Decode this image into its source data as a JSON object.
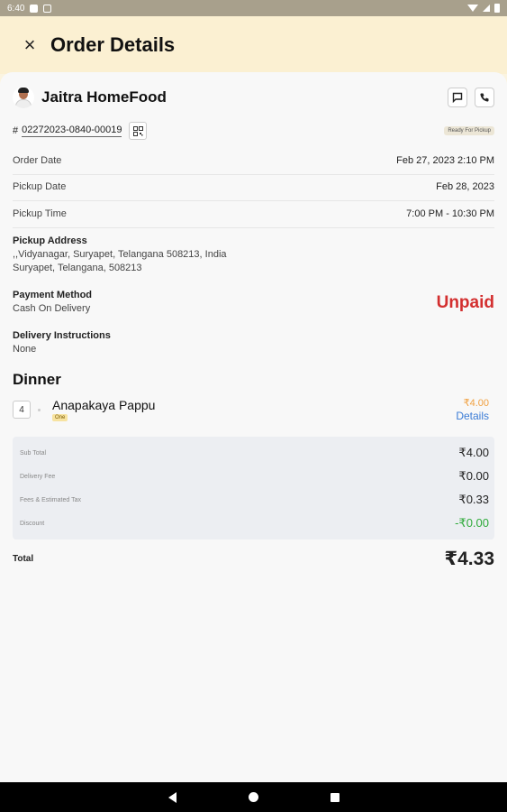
{
  "status_bar": {
    "time": "6:40"
  },
  "header": {
    "title": "Order Details",
    "close_icon": "×"
  },
  "vendor": {
    "name": "Jaitra HomeFood"
  },
  "order": {
    "hash": "#",
    "id": "02272023-0840-00019",
    "status": "Ready For Pickup"
  },
  "details": {
    "order_date_label": "Order Date",
    "order_date_value": "Feb 27, 2023 2:10 PM",
    "pickup_date_label": "Pickup Date",
    "pickup_date_value": "Feb 28, 2023",
    "pickup_time_label": "Pickup Time",
    "pickup_time_value": "7:00 PM - 10:30 PM",
    "pickup_address_label": "Pickup Address",
    "pickup_address_line1": ",,Vidyanagar, Suryapet, Telangana 508213, India",
    "pickup_address_line2": "Suryapet, Telangana, 508213",
    "payment_method_label": "Payment Method",
    "payment_method_value": "Cash On Delivery",
    "payment_status": "Unpaid",
    "delivery_instructions_label": "Delivery Instructions",
    "delivery_instructions_value": "None"
  },
  "section": {
    "title": "Dinner",
    "items": [
      {
        "qty": "4",
        "name": "Anapakaya Pappu",
        "tag": "One",
        "price": "₹4.00",
        "details_label": "Details"
      }
    ]
  },
  "summary": {
    "subtotal_label": "Sub Total",
    "subtotal_value": "₹4.00",
    "delivery_fee_label": "Delivery Fee",
    "delivery_fee_value": "₹0.00",
    "fees_tax_label": "Fees & Estimated Tax",
    "fees_tax_value": "₹0.33",
    "discount_label": "Discount",
    "discount_value": "-₹0.00",
    "total_label": "Total",
    "total_value": "₹4.33"
  },
  "colors": {
    "unpaid": "#d32f2f",
    "details_link": "#3a7bd5",
    "discount": "#2eaa3a",
    "price": "#f0a040",
    "header_bg": "#fbf0d2"
  },
  "icons": {
    "close": "close-icon",
    "message": "message-icon",
    "phone": "phone-icon",
    "qr": "qr-code-icon"
  }
}
